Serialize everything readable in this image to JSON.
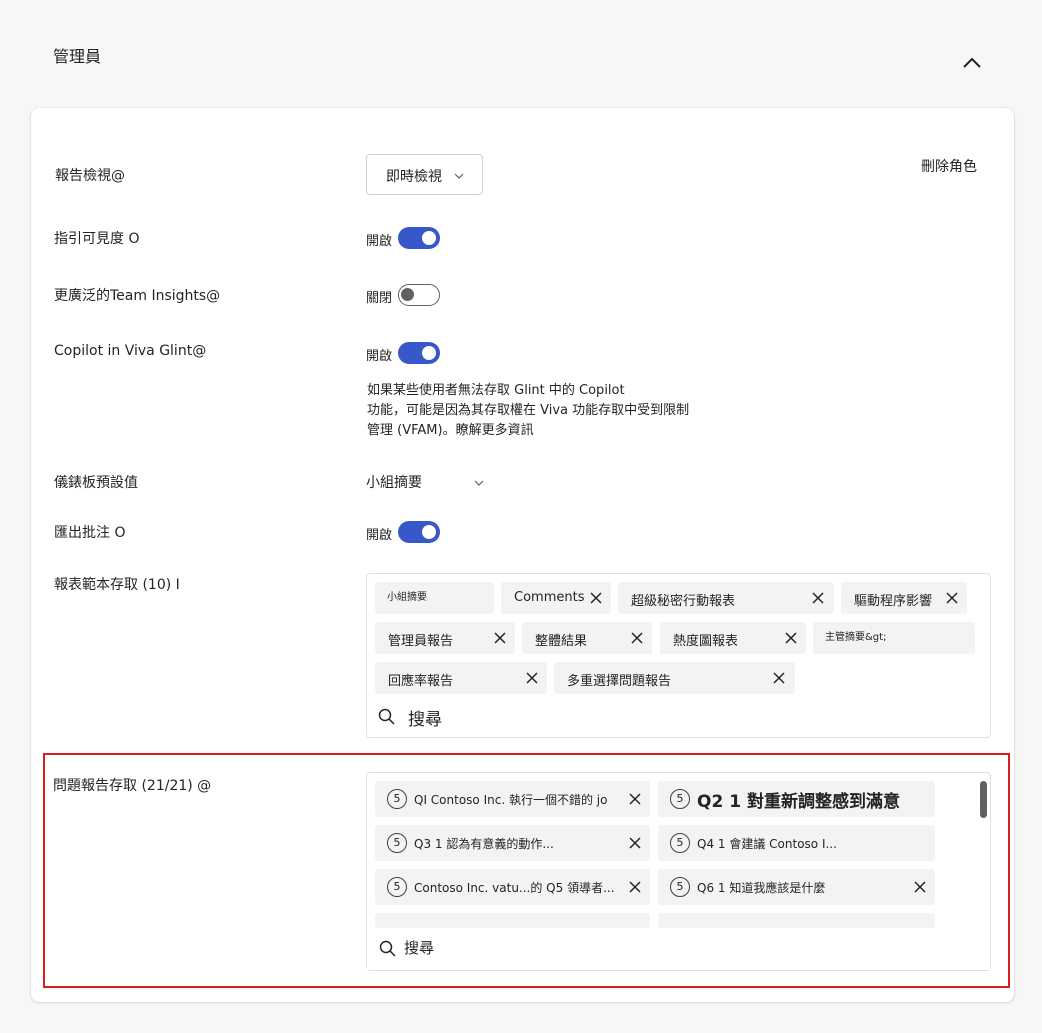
{
  "section": {
    "title": "管理員"
  },
  "rows": {
    "report_view": {
      "label": "報告檢視@",
      "value": "即時檢視"
    },
    "guidance_visibility": {
      "label": "指引可見度 O",
      "state": "開啟"
    },
    "team_insights": {
      "label": "更廣泛的Team Insights@",
      "state": "關閉"
    },
    "copilot": {
      "label": "Copilot in Viva Glint@",
      "state": "開啟",
      "note": [
        "如果某些使用者無法存取 Glint 中的 Copilot",
        "功能，可能是因為其存取權在 Viva 功能存取中受到限制",
        "管理 (VFAM)。瞭解更多資訊"
      ]
    },
    "dashboard_default": {
      "label": "儀錶板預設值",
      "value": "小組摘要"
    },
    "export_comments": {
      "label": "匯出批注 O",
      "state": "開啟"
    },
    "report_templates": {
      "label": "報表範本存取 (10) I",
      "tags": [
        "小組摘要",
        "Comments",
        "超級秘密行動報表",
        "驅動程序影響",
        "管理員報告",
        "整體結果",
        "熱度圖報表",
        "主管摘要&gt;",
        "回應率報告",
        "多重選擇問題報告"
      ],
      "search_label": "搜尋"
    },
    "question_reports": {
      "label": "問題報告存取 (21/21) @",
      "tags": [
        {
          "num": "5",
          "text": "QI  Contoso Inc. 執行一個不錯的 jo"
        },
        {
          "num": "5",
          "text": "Q2 1 對重新調整感到滿意"
        },
        {
          "num": "5",
          "text": "Q3 1 認為有意義的動作..."
        },
        {
          "num": "5",
          "text": "Q4 1 會建議 Contoso I..."
        },
        {
          "num": "5",
          "text": "Contoso Inc. vatu...的 Q5 領導者..."
        },
        {
          "num": "5",
          "text": "Q6 1 知道我應該是什麼"
        }
      ],
      "search_label": "搜尋"
    }
  },
  "actions": {
    "delete_role": "刪除角色"
  },
  "colors": {
    "accent": "#3858c9",
    "highlight": "#d71e22"
  }
}
